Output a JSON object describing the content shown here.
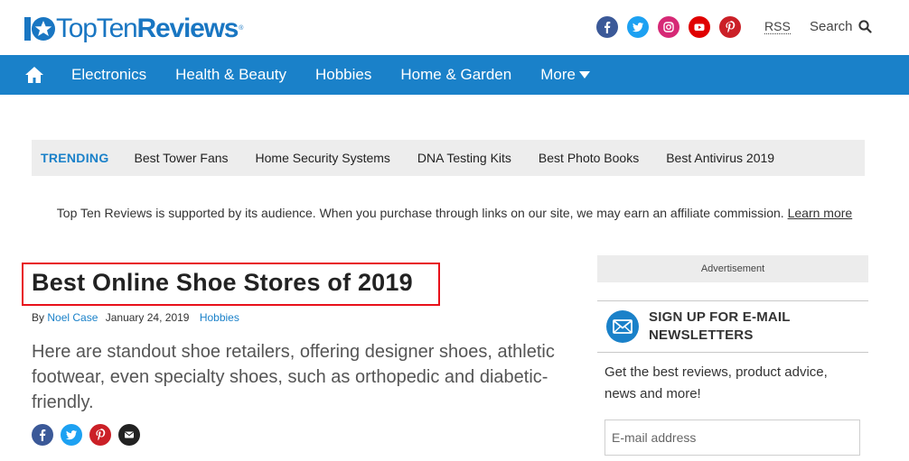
{
  "header": {
    "logo_text_light": "TopTen",
    "logo_text_bold": "Reviews",
    "logo_tm": "®",
    "social_icons": [
      "facebook-icon",
      "twitter-icon",
      "instagram-icon",
      "youtube-icon",
      "pinterest-icon"
    ],
    "rss_label": "RSS",
    "search_label": "Search"
  },
  "nav": {
    "items": [
      {
        "label": "Electronics"
      },
      {
        "label": "Health & Beauty"
      },
      {
        "label": "Hobbies"
      },
      {
        "label": "Home & Garden"
      },
      {
        "label": "More"
      }
    ]
  },
  "trending": {
    "label": "TRENDING",
    "items": [
      {
        "label": "Best Tower Fans"
      },
      {
        "label": "Home Security Systems"
      },
      {
        "label": "DNA Testing Kits"
      },
      {
        "label": "Best Photo Books"
      },
      {
        "label": "Best Antivirus 2019"
      }
    ]
  },
  "disclosure": {
    "text": "Top Ten Reviews is supported by its audience. When you purchase through links on our site, we may earn an affiliate commission. ",
    "link_label": "Learn more"
  },
  "article": {
    "title": "Best Online Shoe Stores of 2019",
    "by_label": "By",
    "author": "Noel Case",
    "date": "January 24, 2019",
    "category": "Hobbies",
    "lede": "Here are standout shoe retailers, offering designer shoes, athletic footwear, even specialty shoes, such as orthopedic and diabetic-friendly.",
    "share_icons": [
      "facebook-icon",
      "twitter-icon",
      "pinterest-icon",
      "email-icon"
    ]
  },
  "sidebar": {
    "ad_label": "Advertisement",
    "newsletter": {
      "title": "SIGN UP FOR E-MAIL NEWSLETTERS",
      "body": "Get the best reviews, product advice, news and more!",
      "input_placeholder": "E-mail address"
    }
  },
  "colors": {
    "brand_blue": "#1a81c9",
    "facebook": "#3b5998",
    "twitter": "#1da1f2",
    "instagram": "#d62976",
    "youtube": "#e00000",
    "pinterest": "#cb2027",
    "highlight_box": "#e8111a"
  }
}
